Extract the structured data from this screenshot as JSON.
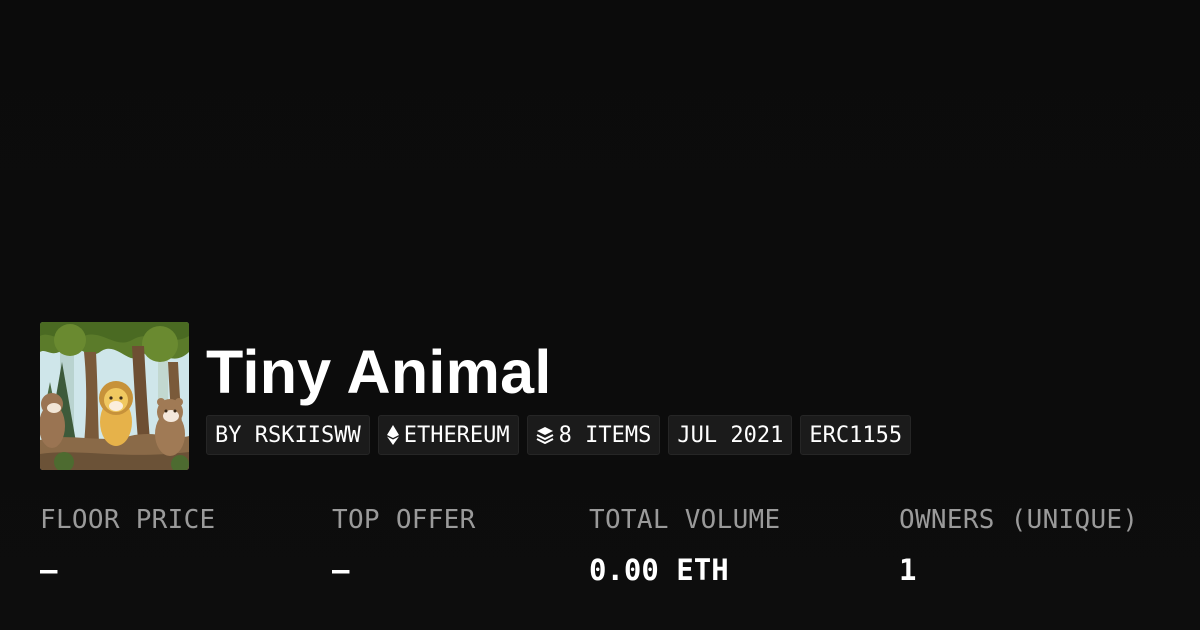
{
  "collection": {
    "title": "Tiny Animal",
    "thumbnail_icon": "forest-animals-artwork"
  },
  "chips": [
    {
      "label": "BY RSKIISWW",
      "icon": null
    },
    {
      "label": "ETHEREUM",
      "icon": "ethereum-icon"
    },
    {
      "label": "8 ITEMS",
      "icon": "layers-icon"
    },
    {
      "label": "JUL 2021",
      "icon": null
    },
    {
      "label": "ERC1155",
      "icon": null
    }
  ],
  "stats": [
    {
      "label": "FLOOR PRICE",
      "value": "–"
    },
    {
      "label": "TOP OFFER",
      "value": "–"
    },
    {
      "label": "TOTAL VOLUME",
      "value": "0.00 ETH"
    },
    {
      "label": "OWNERS (UNIQUE)",
      "value": "1"
    }
  ],
  "colors": {
    "background": "#0b0b0b",
    "chip_background": "#1b1b1b",
    "label_gray": "#9a9a9a",
    "text": "#ffffff"
  }
}
